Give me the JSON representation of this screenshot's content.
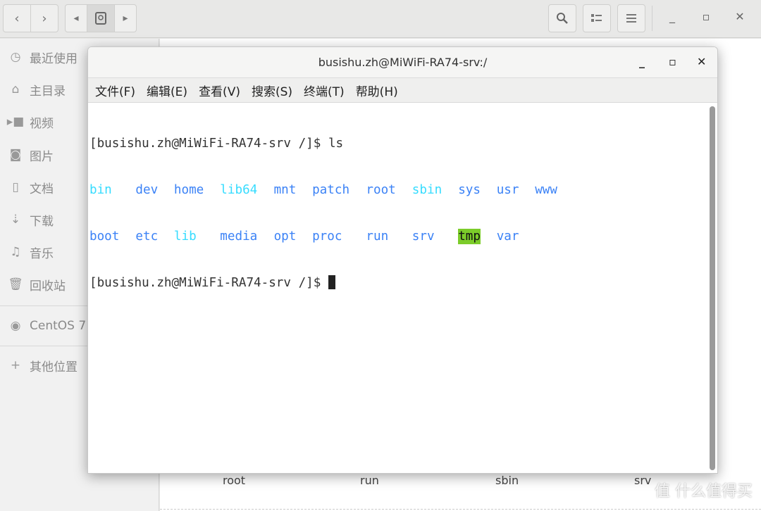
{
  "header": {
    "back": "‹",
    "forward": "›",
    "search_icon": "search-icon",
    "view_icon": "list-view-icon",
    "menu_icon": "hamburger-icon"
  },
  "sidebar": {
    "items": [
      {
        "label": "最近使用",
        "icon": "clock-icon"
      },
      {
        "label": "主目录",
        "icon": "home-icon"
      },
      {
        "label": "视频",
        "icon": "video-icon"
      },
      {
        "label": "图片",
        "icon": "camera-icon"
      },
      {
        "label": "文档",
        "icon": "document-icon"
      },
      {
        "label": "下载",
        "icon": "download-icon"
      },
      {
        "label": "音乐",
        "icon": "music-icon"
      },
      {
        "label": "回收站",
        "icon": "trash-icon"
      }
    ],
    "devices": [
      {
        "label": "CentOS 7 :",
        "icon": "disc-icon"
      }
    ],
    "other": {
      "label": "其他位置",
      "icon": "plus-icon"
    }
  },
  "main": {
    "files": [
      "root",
      "run",
      "sbin",
      "srv"
    ]
  },
  "terminal": {
    "title": "busishu.zh@MiWiFi-RA74-srv:/",
    "menu": [
      "文件(F)",
      "编辑(E)",
      "查看(V)",
      "搜索(S)",
      "终端(T)",
      "帮助(H)"
    ],
    "prompt1": "[busishu.zh@MiWiFi-RA74-srv /]$ ls",
    "prompt2": "[busishu.zh@MiWiFi-RA74-srv /]$ ",
    "ls_row1": [
      {
        "t": "bin",
        "k": "lnk",
        "c": 0
      },
      {
        "t": "dev",
        "k": "dir",
        "c": 6
      },
      {
        "t": "home",
        "k": "dir",
        "c": 11
      },
      {
        "t": "lib64",
        "k": "lnk",
        "c": 17
      },
      {
        "t": "mnt",
        "k": "dir",
        "c": 24
      },
      {
        "t": "patch",
        "k": "dir",
        "c": 29
      },
      {
        "t": "root",
        "k": "dir",
        "c": 36
      },
      {
        "t": "sbin",
        "k": "lnk",
        "c": 42
      },
      {
        "t": "sys",
        "k": "dir",
        "c": 48
      },
      {
        "t": "usr",
        "k": "dir",
        "c": 53
      },
      {
        "t": "www",
        "k": "dir",
        "c": 58
      }
    ],
    "ls_row2": [
      {
        "t": "boot",
        "k": "dir",
        "c": 0
      },
      {
        "t": "etc",
        "k": "dir",
        "c": 6
      },
      {
        "t": "lib",
        "k": "lnk",
        "c": 11
      },
      {
        "t": "media",
        "k": "dir",
        "c": 17
      },
      {
        "t": "opt",
        "k": "dir",
        "c": 24
      },
      {
        "t": "proc",
        "k": "dir",
        "c": 29
      },
      {
        "t": "run",
        "k": "dir",
        "c": 36
      },
      {
        "t": "srv",
        "k": "dir",
        "c": 42
      },
      {
        "t": "tmp",
        "k": "sticky",
        "c": 48
      },
      {
        "t": "var",
        "k": "dir",
        "c": 53
      }
    ],
    "colors": {
      "dir": "#3b82f6",
      "symlink": "#36dcff",
      "sticky_bg": "#7ccc2a"
    }
  },
  "watermark": "值 什么值得买"
}
